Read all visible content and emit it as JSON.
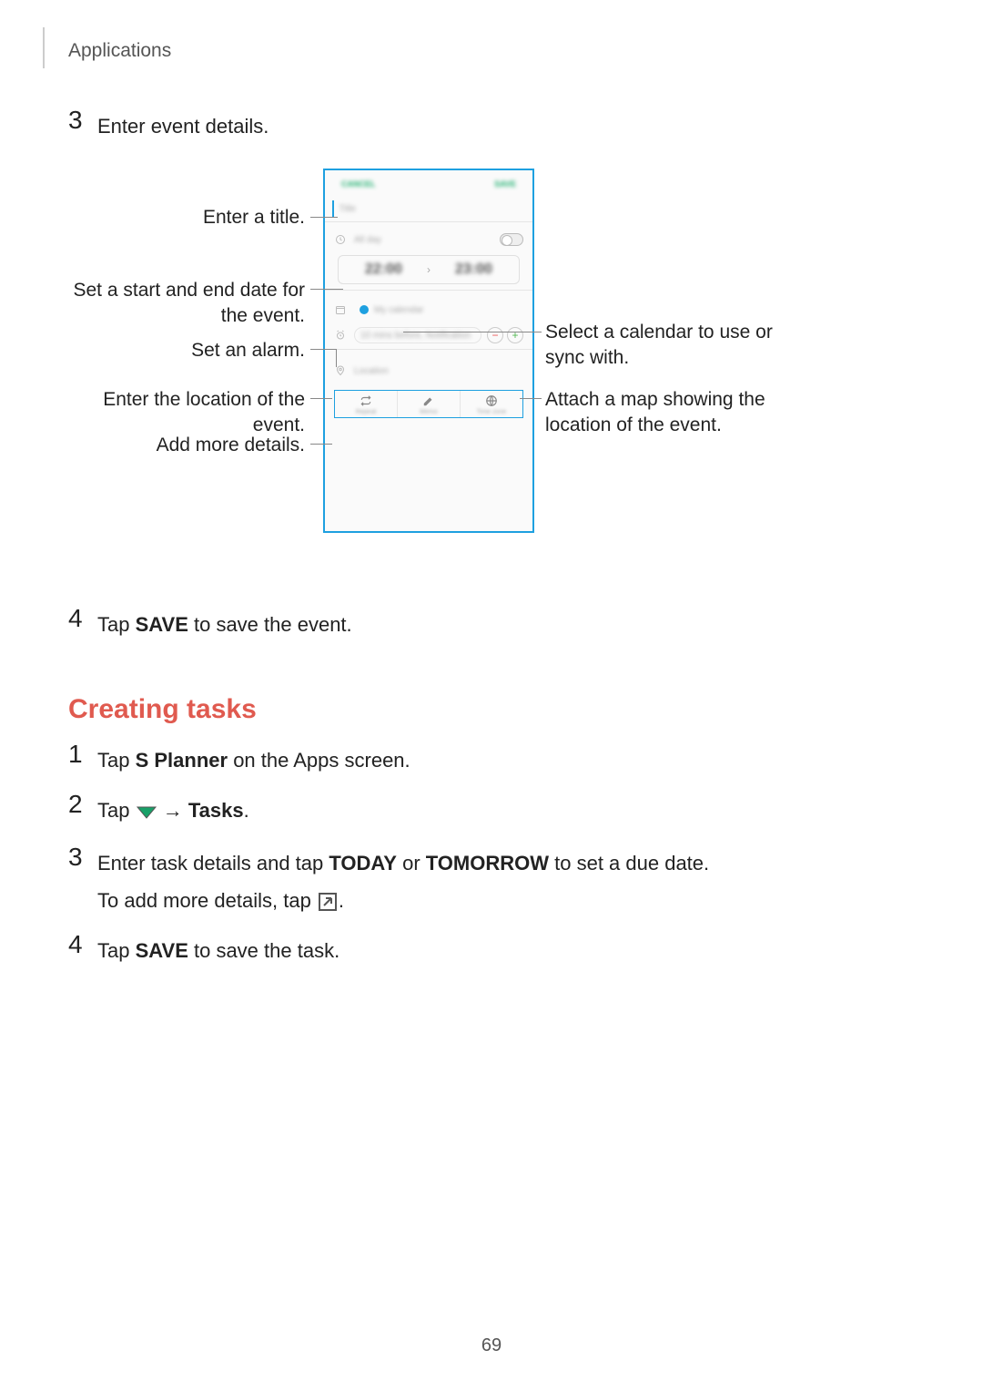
{
  "header": {
    "section": "Applications"
  },
  "step3": {
    "num": "3",
    "text": "Enter event details."
  },
  "diagram": {
    "phone": {
      "cancel": "CANCEL",
      "save": "SAVE",
      "title_placeholder": "Title",
      "all_day": "All day",
      "start_time": "22:00",
      "end_time": "23:00",
      "calendar_label": "My calendar",
      "alarm_label": "10 mins before, Notification",
      "location_placeholder": "Location",
      "more": {
        "repeat": "Repeat",
        "memo": "Memo",
        "timezone": "Time zone"
      }
    },
    "callouts": {
      "title": "Enter a title.",
      "dates": "Set a start and end date for the event.",
      "alarm": "Set an alarm.",
      "location": "Enter the location of the event.",
      "more": "Add more details.",
      "calendar": "Select a calendar to use or sync with.",
      "map": "Attach a map showing the location of the event."
    }
  },
  "step4": {
    "num": "4",
    "pre": "Tap ",
    "bold": "SAVE",
    "post": " to save the event."
  },
  "section": {
    "heading": "Creating tasks"
  },
  "tstep1": {
    "num": "1",
    "pre": "Tap ",
    "bold": "S Planner",
    "post": " on the Apps screen."
  },
  "tstep2": {
    "num": "2",
    "pre": "Tap ",
    "arrow": " → ",
    "bold": "Tasks",
    "post": "."
  },
  "tstep3": {
    "num": "3",
    "p1a": "Enter task details and tap ",
    "p1b": "TODAY",
    "p1c": " or ",
    "p1d": "TOMORROW",
    "p1e": " to set a due date.",
    "p2a": "To add more details, tap ",
    "p2b": "."
  },
  "tstep4": {
    "num": "4",
    "pre": "Tap ",
    "bold": "SAVE",
    "post": " to save the task."
  },
  "page_number": "69"
}
